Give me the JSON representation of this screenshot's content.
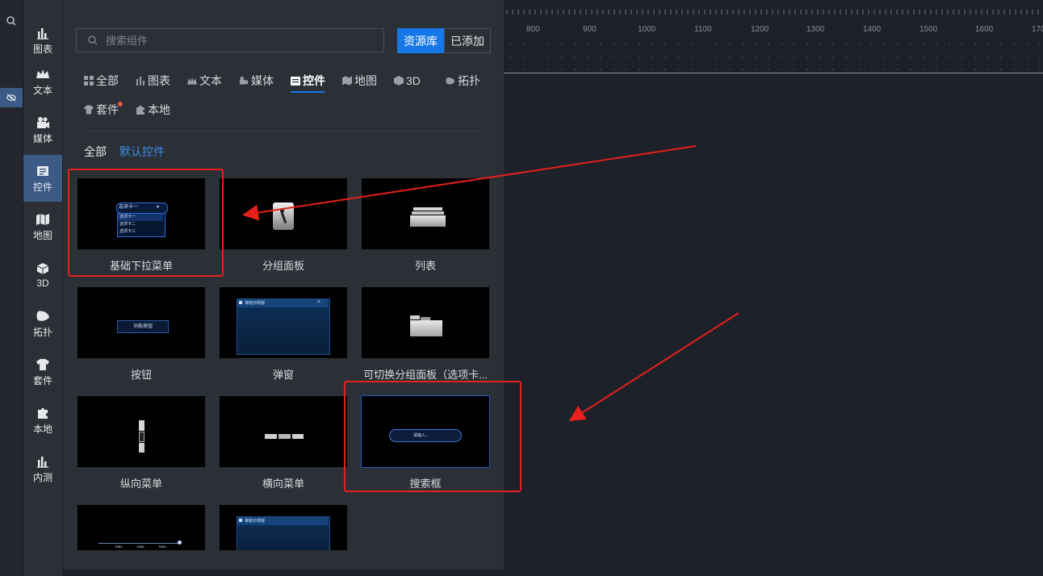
{
  "nav": {
    "items": [
      {
        "label": "图表",
        "icon": "bar-chart-icon"
      },
      {
        "label": "文本",
        "icon": "crown-icon"
      },
      {
        "label": "媒体",
        "icon": "camera-icon"
      },
      {
        "label": "控件",
        "icon": "widget-icon"
      },
      {
        "label": "地图",
        "icon": "map-icon"
      },
      {
        "label": "3D",
        "icon": "cube-icon"
      },
      {
        "label": "拓扑",
        "icon": "topology-icon"
      },
      {
        "label": "套件",
        "icon": "shirt-icon"
      },
      {
        "label": "本地",
        "icon": "puzzle-icon"
      },
      {
        "label": "内测",
        "icon": "bar-chart-icon"
      }
    ],
    "active_index": 3
  },
  "search": {
    "placeholder": "搜索组件",
    "value": ""
  },
  "tabs": {
    "resource": "资源库",
    "added": "已添加"
  },
  "categories": [
    {
      "label": "全部",
      "icon": "grid-icon"
    },
    {
      "label": "图表",
      "icon": "bar-chart-icon"
    },
    {
      "label": "文本",
      "icon": "crown-icon"
    },
    {
      "label": "媒体",
      "icon": "camera-icon"
    },
    {
      "label": "控件",
      "icon": "widget-icon"
    },
    {
      "label": "地图",
      "icon": "map-icon"
    },
    {
      "label": "3D",
      "icon": "cube-icon"
    },
    {
      "label": "拓扑",
      "icon": "topology-icon"
    },
    {
      "label": "套件",
      "icon": "shirt-icon"
    },
    {
      "label": "本地",
      "icon": "puzzle-icon"
    }
  ],
  "active_category": "控件",
  "subfilter": {
    "all": "全部",
    "default": "默认控件"
  },
  "cards": [
    {
      "title": "基础下拉菜单",
      "thumb": "dropdown"
    },
    {
      "title": "分组面板",
      "thumb": "group-panel"
    },
    {
      "title": "列表",
      "thumb": "list"
    },
    {
      "title": "按钮",
      "thumb": "button"
    },
    {
      "title": "弹窗",
      "thumb": "popup"
    },
    {
      "title": "可切换分组面板（选项卡...",
      "thumb": "tab-panel"
    },
    {
      "title": "纵向菜单",
      "thumb": "vertical-menu"
    },
    {
      "title": "横向菜单",
      "thumb": "horizontal-menu"
    },
    {
      "title": "搜索框",
      "thumb": "search-box"
    },
    {
      "title": "",
      "thumb": "timeline"
    },
    {
      "title": "",
      "thumb": "popup"
    }
  ],
  "thumb_text": {
    "dropdown_selected": "选项卡一",
    "dropdown_options": [
      "选项卡一",
      "选项卡二",
      "选项卡三"
    ],
    "button": "功能按钮",
    "popup": "弹窗示例窗",
    "search": "请输入...",
    "timeline": [
      "TAB1",
      "TAB2",
      "TAB3"
    ]
  },
  "ruler": {
    "ticks": [
      "800",
      "900",
      "1000",
      "1100",
      "1200",
      "1300",
      "1400",
      "1500",
      "1600",
      "170"
    ]
  },
  "colors": {
    "accent": "#1677e6",
    "annotation": "#e6201b",
    "panel": "#2b2f36",
    "canvas": "#1d2129"
  }
}
